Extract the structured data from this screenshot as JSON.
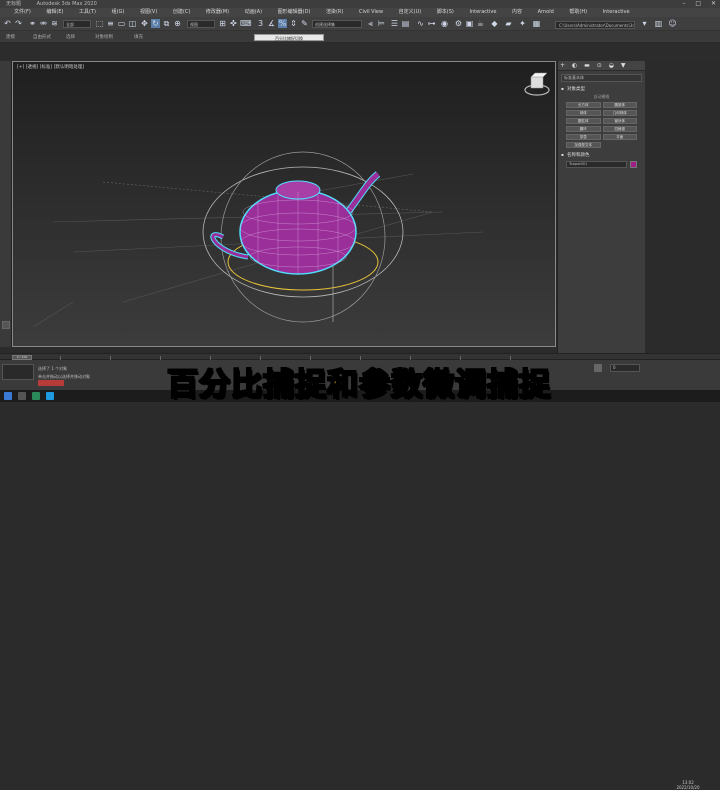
{
  "titlebar": {
    "app_label": "Autodesk 3ds Max 2020",
    "short_title": "无标题",
    "controls": [
      "–",
      "□",
      "✕"
    ]
  },
  "menubar": {
    "items": [
      "文件(F)",
      "编辑(E)",
      "工具(T)",
      "组(G)",
      "视图(V)",
      "创建(C)",
      "修改器(M)",
      "动画(A)",
      "图形编辑器(D)",
      "渲染(R)",
      "Civil View",
      "自定义(U)",
      "脚本(S)",
      "Interactive",
      "内容",
      "Arnold",
      "帮助(H)",
      "Interactive"
    ]
  },
  "toolbar": {
    "select_filter": "全部",
    "view_mode": "视图",
    "named_set": "创建选择集",
    "workspace_path": "C:\\Users\\Administrator\\Documents\\3ds Max 2020"
  },
  "toolbar2": {
    "tabs": [
      "建模",
      "自由形式",
      "选择",
      "对象绘制",
      "填充"
    ]
  },
  "tooltip": {
    "text": "百分比捕捉切换"
  },
  "viewport": {
    "label": "[+] [透视] [标准] [默认明暗处理]"
  },
  "command_panel": {
    "tab_icons": [
      "+",
      "◐",
      "▬",
      "⊙",
      "◒",
      "▼"
    ],
    "dropdown": "标准基本体",
    "section_object_type": "对象类型",
    "autogrid": "自动栅格",
    "buttons": [
      "长方体",
      "圆锥体",
      "球体",
      "几何球体",
      "圆柱体",
      "管状体",
      "圆环",
      "四棱锥",
      "茶壶",
      "平面",
      "加强型文本",
      ""
    ],
    "section_name_color": "名称和颜色",
    "object_name": "Teapot001",
    "object_color": "#a0208a"
  },
  "timeline": {
    "slider_label": "0 / 100"
  },
  "statusbar": {
    "selected_text": "选择了 1 个对象",
    "hint_text": "单击并拖动以选择并移动对象",
    "frame_value": "0",
    "clock_time": "13:02",
    "clock_date": "2022/10/20"
  },
  "caption": {
    "text": "百分比捕捉和参数微调捕捉"
  },
  "colors": {
    "teapot_fill": "#9a2f9a",
    "teapot_wire": "#e0b8e8",
    "selection_cyan": "#4fe0ff",
    "gizmo_yellow": "#e8c43a",
    "caption_yellow": "#ffd400"
  }
}
